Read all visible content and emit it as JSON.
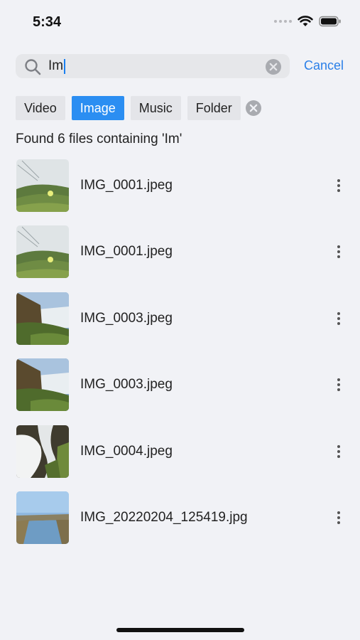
{
  "status_bar": {
    "time": "5:34"
  },
  "search": {
    "value": "Im",
    "cancel_label": "Cancel"
  },
  "filters": [
    {
      "label": "Video",
      "active": false
    },
    {
      "label": "Image",
      "active": true
    },
    {
      "label": "Music",
      "active": false
    },
    {
      "label": "Folder",
      "active": false
    }
  ],
  "results": {
    "summary": "Found 6 files containing 'Im'",
    "files": [
      {
        "name": "IMG_0001.jpeg",
        "thumbnail": "meadow-flower"
      },
      {
        "name": "IMG_0001.jpeg",
        "thumbnail": "meadow-flower"
      },
      {
        "name": "IMG_0003.jpeg",
        "thumbnail": "waterfall"
      },
      {
        "name": "IMG_0003.jpeg",
        "thumbnail": "waterfall"
      },
      {
        "name": "IMG_0004.jpeg",
        "thumbnail": "cascade"
      },
      {
        "name": "IMG_20220204_125419.jpg",
        "thumbnail": "river"
      }
    ]
  },
  "colors": {
    "accent": "#2b8ef2",
    "link": "#2a7fe8",
    "background": "#f1f2f6"
  }
}
